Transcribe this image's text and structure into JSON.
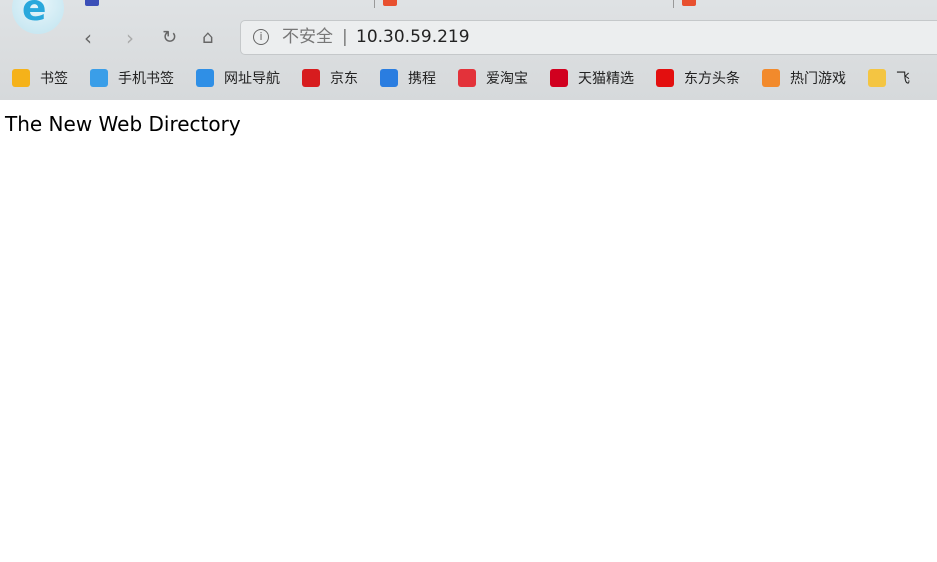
{
  "address_bar": {
    "security_label": "不安全",
    "url": "10.30.59.219"
  },
  "bookmarks": [
    {
      "label": "书签",
      "icon": "star-icon",
      "color": "#f5b21a"
    },
    {
      "label": "手机书签",
      "icon": "phone-icon",
      "color": "#3a9ee8"
    },
    {
      "label": "网址导航",
      "icon": "navigation-icon",
      "color": "#2f8fe6"
    },
    {
      "label": "京东",
      "icon": "jd-icon",
      "color": "#d71c1e"
    },
    {
      "label": "携程",
      "icon": "ctrip-icon",
      "color": "#2a7de0"
    },
    {
      "label": "爱淘宝",
      "icon": "taobao-icon",
      "color": "#e3323a"
    },
    {
      "label": "天猫精选",
      "icon": "tmall-icon",
      "color": "#d1001f"
    },
    {
      "label": "东方头条",
      "icon": "dftt-icon",
      "color": "#e30f0f"
    },
    {
      "label": "热门游戏",
      "icon": "game-icon",
      "color": "#f28a2c"
    },
    {
      "label": "飞",
      "icon": "fei-icon",
      "color": "#f4c542"
    }
  ],
  "page": {
    "heading": "The New Web Directory"
  }
}
